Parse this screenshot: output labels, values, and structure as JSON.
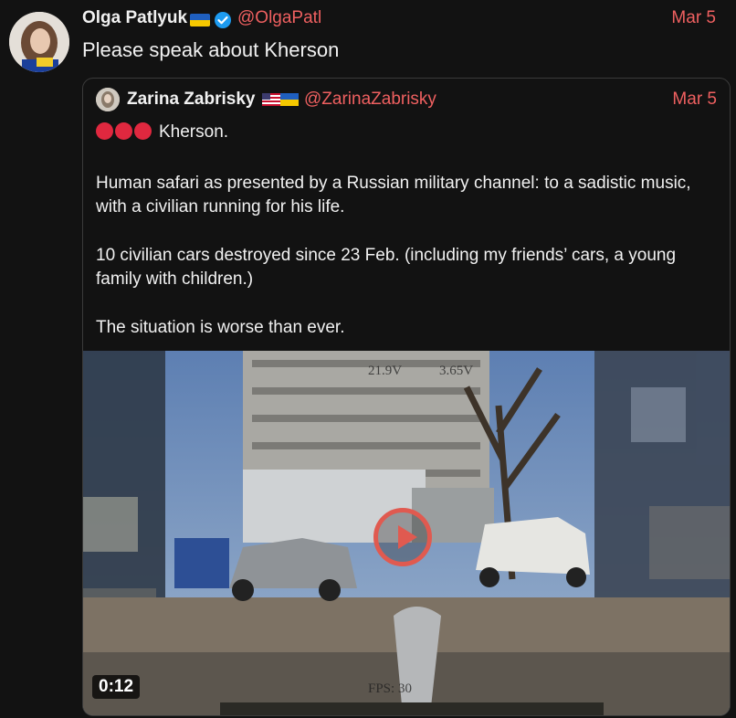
{
  "tweet": {
    "author_name": "Olga Patlyuk",
    "author_handle": "@OlgaPatl",
    "date": "Mar 5",
    "text": "Please speak about Kherson"
  },
  "quoted_tweet": {
    "author_name": "Zarina Zabrisky",
    "author_handle": "@ZarinaZabrisky",
    "date": "Mar 5",
    "lead_text": "Kherson.",
    "paragraphs": [
      "Human safari as presented by a Russian military channel: to a sadistic music, with a civilian running for his life.",
      "10 civilian cars destroyed since 23 Feb. (including my friends’ cars, a young family with children.)",
      "The situation is worse than ever."
    ],
    "video": {
      "duration": "0:12",
      "osd_voltage": "21.9V",
      "osd_cell": "3.65V",
      "osd_fps": "FPS: 30"
    }
  },
  "colors": {
    "accent": "#ef6060",
    "background": "#121212",
    "red_dot": "#e0283f",
    "play": "#e05a50"
  },
  "icons": [
    "verified-badge-icon",
    "ukraine-flag-icon",
    "usa-flag-icon",
    "red-circle-icon",
    "play-icon"
  ]
}
